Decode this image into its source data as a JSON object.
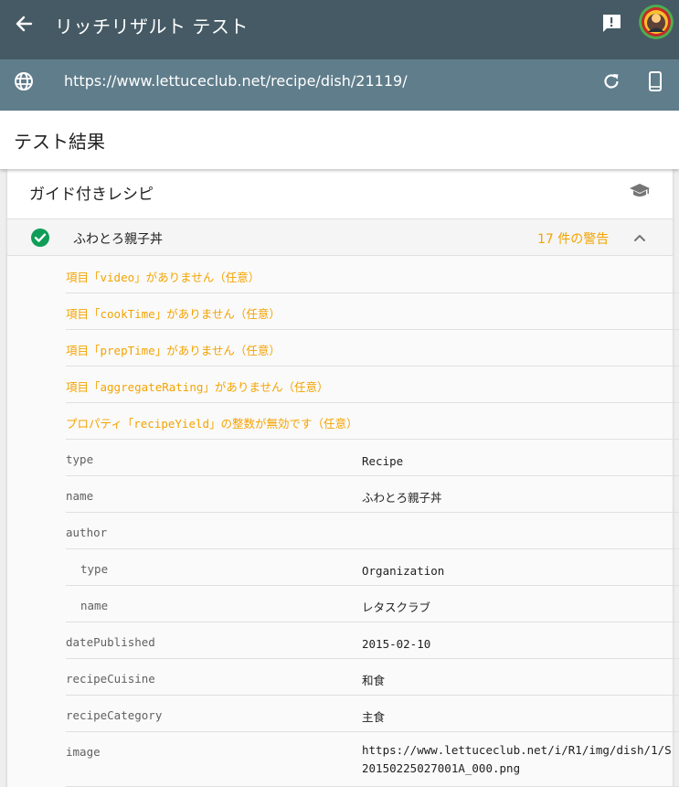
{
  "app": {
    "title": "リッチリザルト テスト"
  },
  "url": {
    "value": "https://www.lettuceclub.net/recipe/dish/21119/"
  },
  "results": {
    "title": "テスト結果"
  },
  "section": {
    "title": "ガイド付きレシピ"
  },
  "item": {
    "name": "ふわとろ親子丼",
    "warning_count": "17 件の警告"
  },
  "warnings": [
    "項目「video」がありません（任意）",
    "項目「cookTime」がありません（任意）",
    "項目「prepTime」がありません（任意）",
    "項目「aggregateRating」がありません（任意）",
    "プロパティ「recipeYield」の整数が無効です（任意）"
  ],
  "properties": [
    {
      "key": "type",
      "value": "Recipe"
    },
    {
      "key": "name",
      "value": "ふわとろ親子丼"
    },
    {
      "key": "author",
      "value": ""
    },
    {
      "key": "type",
      "value": "Organization"
    },
    {
      "key": "name",
      "value": "レタスクラブ"
    },
    {
      "key": "datePublished",
      "value": "2015-02-10"
    },
    {
      "key": "recipeCuisine",
      "value": "和食"
    },
    {
      "key": "recipeCategory",
      "value": "主食"
    },
    {
      "key": "image",
      "value": "https://www.lettuceclub.net/i/R1/img/dish/1/S20150225027001A_000.png"
    }
  ],
  "colors": {
    "topbar": "#455a64",
    "urlbar": "#607d8b",
    "warning": "#f4a300",
    "success": "#0f9d58"
  },
  "icons": [
    "back-arrow-icon",
    "feedback-icon",
    "globe-icon",
    "reload-icon",
    "mobile-device-icon",
    "graduation-cap-icon",
    "check-circle-icon",
    "chevron-up-icon"
  ]
}
